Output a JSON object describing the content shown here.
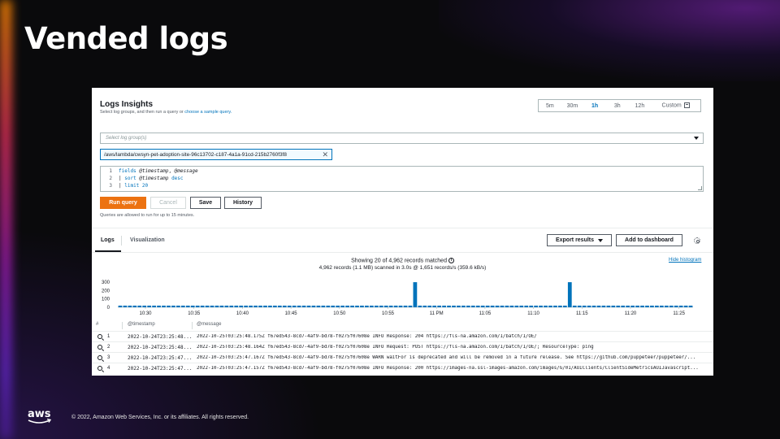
{
  "slide": {
    "title": "Vended logs",
    "logo": "aws",
    "copyright": "© 2022, Amazon Web Services, Inc. or its affiliates. All rights reserved."
  },
  "insights": {
    "title": "Logs Insights",
    "subtitle_prefix": "Select log groups, and then run a query or ",
    "subtitle_link": "choose a sample query.",
    "time_ranges": [
      "5m",
      "30m",
      "1h",
      "3h",
      "12h",
      "Custom"
    ],
    "active_range": "1h",
    "log_group_placeholder": "Select log group(s)",
    "selected_log_group": "/aws/lambda/cwsyn-pet-adoption-site-96c13702-c187-4a1a-91cd-215b2760f3f8",
    "query_lines": [
      {
        "n": "1",
        "text": "fields @timestamp, @message"
      },
      {
        "n": "2",
        "text": "| sort @timestamp desc"
      },
      {
        "n": "3",
        "text": "| limit 20"
      }
    ],
    "buttons": {
      "run": "Run query",
      "cancel": "Cancel",
      "save": "Save",
      "history": "History"
    },
    "hint": "Queries are allowed to run for up to 15 minutes."
  },
  "results": {
    "tabs": [
      "Logs",
      "Visualization"
    ],
    "active_tab": "Logs",
    "export_label": "Export results",
    "add_dashboard_label": "Add to dashboard",
    "summary_line1": "Showing 20 of 4,962 records matched",
    "summary_line2": "4,962 records (1.1 MB) scanned in 3.0s @ 1,651 records/s (359.6 kB/s)",
    "hide_histogram": "Hide histogram",
    "columns": [
      "#",
      "@timestamp",
      "@message"
    ],
    "rows": [
      {
        "num": "1",
        "ts": "2022-10-24T23:25:48...",
        "msg": "2022-10-25T03:25:48.175Z f67ed543-8cd7-4af9-bd78-f0275f07608e INFO Response: 204 https://fls-na.amazon.com/1/batch/1/OE/"
      },
      {
        "num": "2",
        "ts": "2022-10-24T23:25:48...",
        "msg": "2022-10-25T03:25:48.164Z f67ed543-8cd7-4af9-bd78-f0275f07608e INFO Request: POST https://fls-na.amazon.com/1/batch/1/OE/; ResourceType: ping"
      },
      {
        "num": "3",
        "ts": "2022-10-24T23:25:47...",
        "msg": "2022-10-25T03:25:47.167Z f67ed543-8cd7-4af9-bd78-f0275f07608e WARN waitFor is deprecated and will be removed in a future release. See https://github.com/puppeteer/puppeteer/..."
      },
      {
        "num": "4",
        "ts": "2022-10-24T23:25:47...",
        "msg": "2022-10-25T03:25:47.157Z f67ed543-8cd7-4af9-bd78-f0275f07608e INFO Response: 200 https://images-na.ssl-images-amazon.com/images/G/01/AUIClients/ClientSideMetricsAUIJavascript..."
      }
    ]
  },
  "chart_data": {
    "type": "bar",
    "y_ticks": [
      "300",
      "200",
      "100",
      "0"
    ],
    "ylim": [
      0,
      340
    ],
    "x_tick_labels": [
      "10:30",
      "10:35",
      "10:40",
      "10:45",
      "10:50",
      "10:55",
      "11 PM",
      "11:05",
      "11:10",
      "11:15",
      "11:20",
      "11:25"
    ],
    "values": [
      20,
      20,
      20,
      20,
      20,
      20,
      20,
      20,
      20,
      20,
      20,
      20,
      20,
      20,
      20,
      20,
      20,
      20,
      20,
      20,
      20,
      20,
      20,
      20,
      20,
      20,
      20,
      20,
      20,
      20,
      20,
      20,
      20,
      20,
      20,
      20,
      20,
      20,
      20,
      20,
      20,
      20,
      20,
      20,
      20,
      20,
      20,
      20,
      20,
      20,
      20,
      20,
      20,
      20,
      20,
      20,
      20,
      20,
      20,
      20,
      20,
      300,
      20,
      20,
      20,
      20,
      20,
      20,
      20,
      20,
      20,
      20,
      20,
      20,
      20,
      20,
      20,
      20,
      20,
      20,
      20,
      20,
      20,
      20,
      20,
      20,
      20,
      20,
      20,
      20,
      20,
      20,
      20,
      300,
      20,
      20,
      20,
      20,
      20,
      20,
      20,
      20,
      20,
      20,
      20,
      20,
      20,
      20,
      20,
      20,
      20,
      20,
      20,
      20,
      20,
      20,
      20,
      20,
      20
    ]
  },
  "colors": {
    "primary_button": "#ec7211",
    "bar": "#0073bb",
    "link": "#0073bb"
  }
}
